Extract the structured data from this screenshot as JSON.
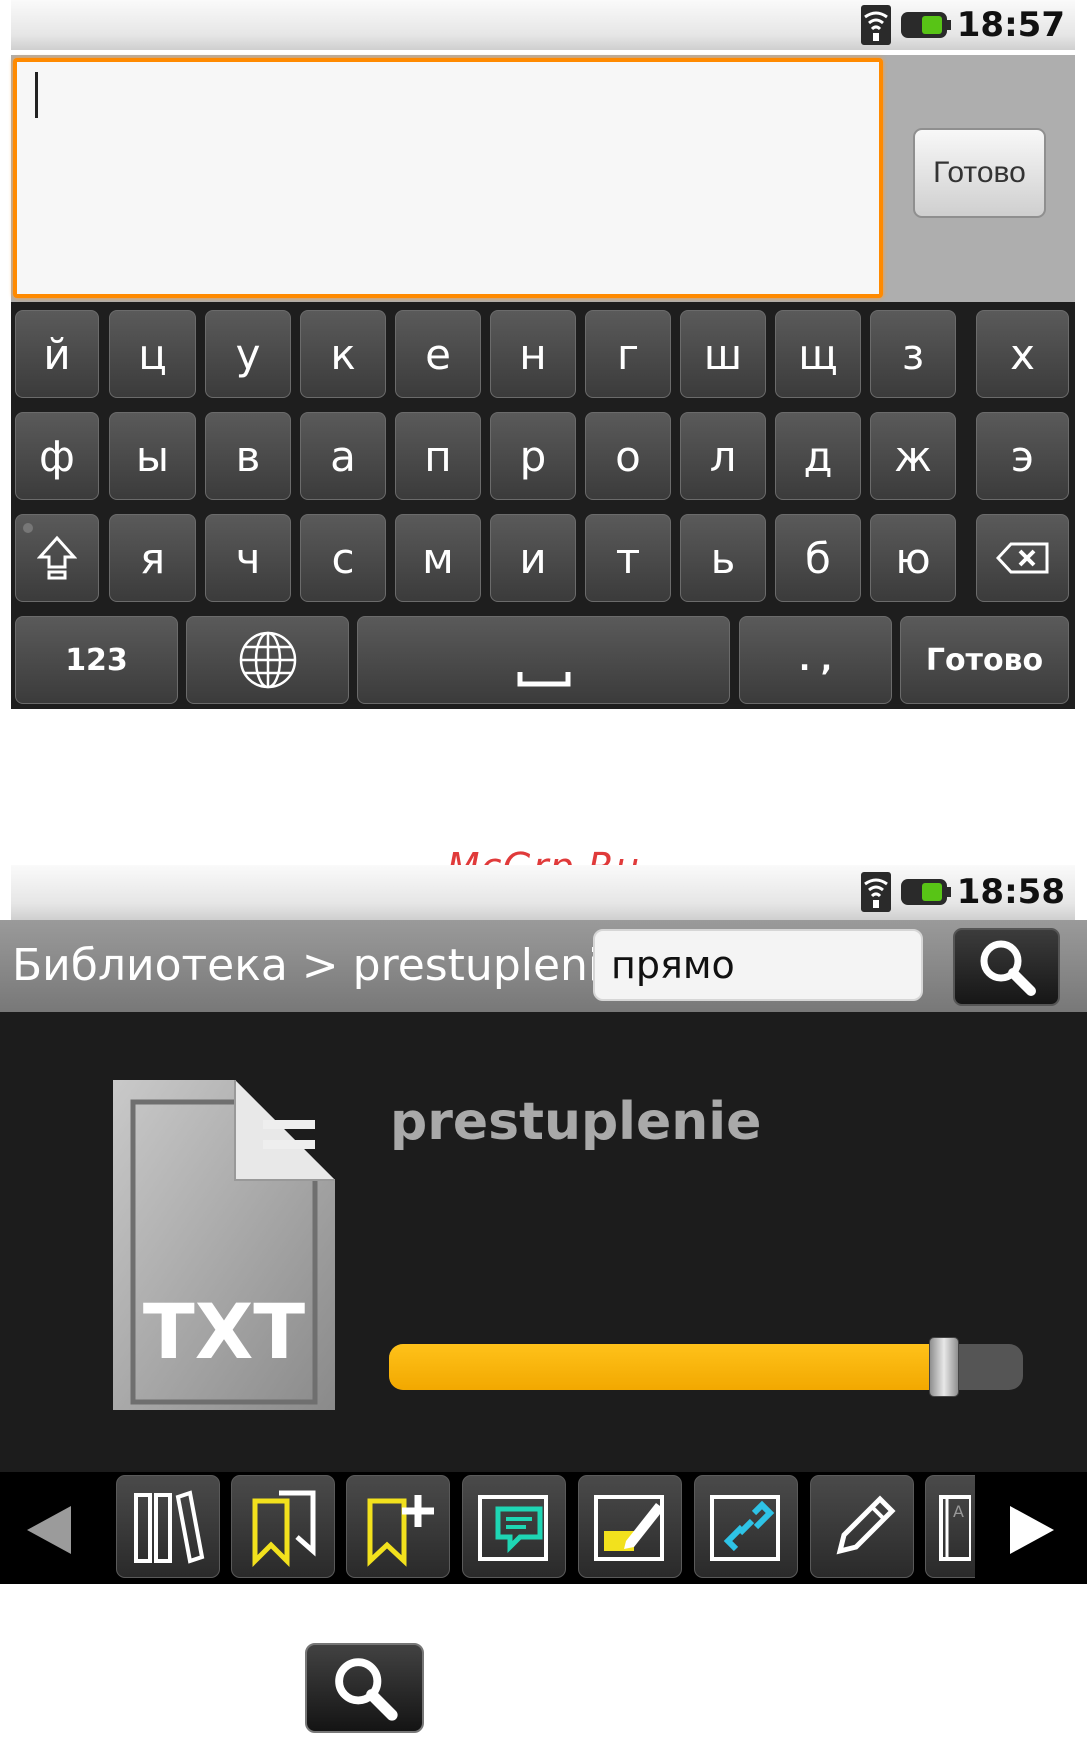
{
  "screen1": {
    "status": {
      "time": "18:57"
    },
    "edit": {
      "value": "",
      "done_label": "Готово"
    },
    "keyboard": {
      "row1": [
        "й",
        "ц",
        "у",
        "к",
        "е",
        "н",
        "г",
        "ш",
        "щ",
        "з",
        "х"
      ],
      "row2": [
        "ф",
        "ы",
        "в",
        "а",
        "п",
        "р",
        "о",
        "л",
        "д",
        "ж",
        "э"
      ],
      "row3": [
        "я",
        "ч",
        "с",
        "м",
        "и",
        "т",
        "ь",
        "б",
        "ю"
      ],
      "numbers_label": "123",
      "punct_label": ". ,",
      "done_label": "Готово",
      "icons": {
        "shift": "shift-icon",
        "backspace": "backspace-icon",
        "language": "globe-icon",
        "space": "space-icon"
      }
    }
  },
  "watermark": "McGrp.Ru",
  "screen2": {
    "status": {
      "time": "18:58"
    },
    "header": {
      "breadcrumb": "Библиотека > prestuplenie",
      "search_value": "прямо",
      "search_icon": "search-icon"
    },
    "book": {
      "title": "prestuplenie",
      "format": "TXT",
      "progress_fraction": 0.88
    },
    "toolbar": {
      "icons": [
        "library-icon",
        "bookmarks-icon",
        "add-bookmark-icon",
        "comment-icon",
        "highlight-icon",
        "link-icon",
        "pencil-icon",
        "dictionary-icon"
      ],
      "colors": {
        "bookmark": "#f2e11d",
        "comment": "#1ed6b4",
        "highlight": "#f2e11d",
        "link": "#2ec3e6"
      }
    }
  },
  "colors": {
    "accent_orange": "#ff8a00",
    "progress_yellow": "#ffc21a",
    "watermark_red": "#e03a3a"
  }
}
